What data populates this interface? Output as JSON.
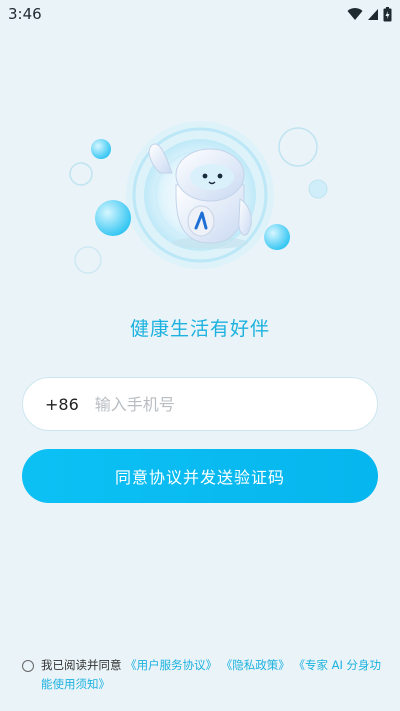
{
  "status_bar": {
    "time": "3:46"
  },
  "slogan": "健康生活有好伴",
  "phone": {
    "country_code": "+86",
    "placeholder": "输入手机号",
    "value": ""
  },
  "send_button_label": "同意协议并发送验证码",
  "agreement": {
    "checked": false,
    "prefix": "我已阅读并同意",
    "links": [
      "《用户服务协议》",
      "《隐私政策》",
      "《专家 AI 分身功能使用须知》"
    ]
  },
  "colors": {
    "accent": "#1cb2df",
    "button": "#06b6ee",
    "background": "#eaf3f8"
  },
  "icons": {
    "wifi": "wifi-icon",
    "cellular": "cellular-signal-icon",
    "battery": "battery-charging-icon"
  }
}
